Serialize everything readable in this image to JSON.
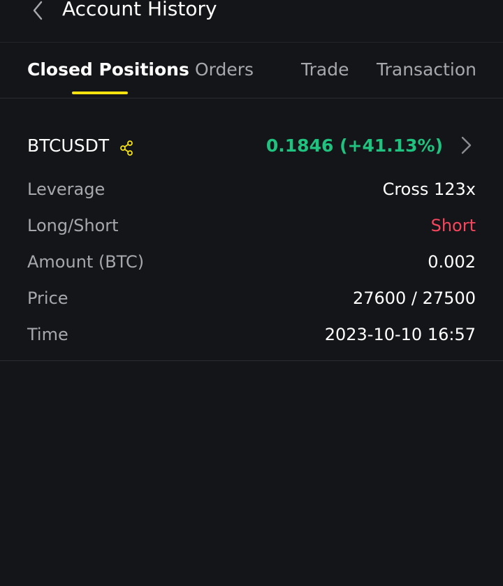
{
  "header": {
    "title": "Account History",
    "back_icon": "chevron-left-icon"
  },
  "tabs": [
    {
      "label": "Closed Positions",
      "active": true
    },
    {
      "label": "Orders",
      "active": false
    },
    {
      "label": "Trade",
      "active": false
    },
    {
      "label": "Transaction",
      "active": false
    }
  ],
  "position": {
    "symbol": "BTCUSDT",
    "share_icon": "share-icon",
    "pnl": "0.1846 (+41.13%)",
    "details_icon": "chevron-right-icon",
    "rows": [
      {
        "label": "Leverage",
        "value": "Cross 123x"
      },
      {
        "label": "Long/Short",
        "value": "Short"
      },
      {
        "label": "Amount (BTC)",
        "value": "0.002"
      },
      {
        "label": "Price",
        "value": "27600 / 27500"
      },
      {
        "label": "Time",
        "value": "2023-10-10 16:57"
      }
    ]
  },
  "colors": {
    "background": "#141519",
    "accent": "#f5e20f",
    "profit": "#1fc27e",
    "short": "#f6465d",
    "label": "#a6a8ad"
  }
}
